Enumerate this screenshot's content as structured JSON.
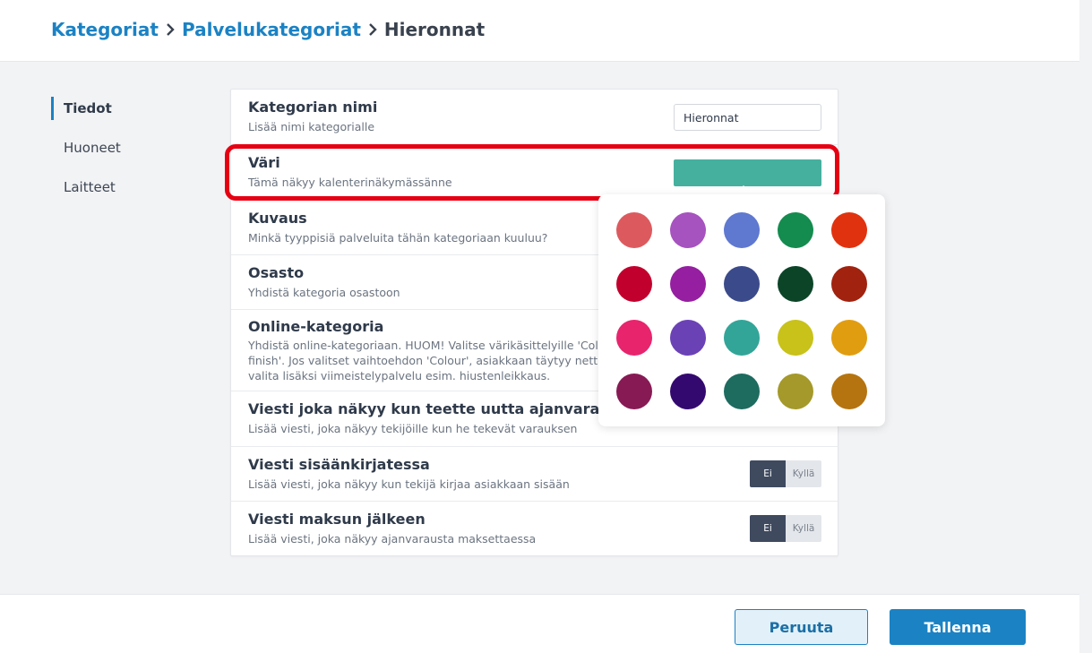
{
  "breadcrumb": {
    "items": [
      "Kategoriat",
      "Palvelukategoriat"
    ],
    "current": "Hieronnat"
  },
  "sidebar": {
    "items": [
      {
        "label": "Tiedot",
        "active": true
      },
      {
        "label": "Huoneet",
        "active": false
      },
      {
        "label": "Laitteet",
        "active": false
      }
    ]
  },
  "form": {
    "name": {
      "title": "Kategorian nimi",
      "desc": "Lisää nimi kategorialle",
      "value": "Hieronnat"
    },
    "color": {
      "title": "Väri",
      "desc": "Tämä näkyy kalenterinäkymässänne",
      "value": "#45b09e"
    },
    "description": {
      "title": "Kuvaus",
      "desc": "Minkä tyyppisiä palveluita tähän kategoriaan kuuluu?"
    },
    "department": {
      "title": "Osasto",
      "desc": "Yhdistä kategoria osastoon"
    },
    "online": {
      "title": "Online-kategoria",
      "desc_lines": [
        "Yhdistä online-kategoriaan. HUOM! Valitse värikäsittelyille 'Colour",
        "finish'. Jos valitset vaihtoehdon 'Colour', asiakkaan täytyy nettiajan",
        "valita lisäksi viimeistelypalvelu esim. hiustenleikkaus."
      ]
    },
    "booking_message": {
      "title": "Viesti joka näkyy kun teette uutta ajanvarausta",
      "desc": "Lisää viesti, joka näkyy tekijöille kun he tekevät varauksen"
    },
    "checkin_message": {
      "title": "Viesti sisäänkirjatessa",
      "desc": "Lisää viesti, joka näkyy kun tekijä kirjaa asiakkaan sisään",
      "off_label": "Ei",
      "on_label": "Kyllä"
    },
    "payment_message": {
      "title": "Viesti maksun jälkeen",
      "desc": "Lisää viesti, joka näkyy ajanvarausta maksettaessa",
      "off_label": "Ei",
      "on_label": "Kyllä"
    }
  },
  "palette": {
    "colors": [
      [
        "#dc5a5e",
        "#a652bf",
        "#5f78d0",
        "#148c4f",
        "#e1320f"
      ],
      [
        "#c2002d",
        "#951fa0",
        "#3b4a8a",
        "#0c4428",
        "#a0220f"
      ],
      [
        "#e8246d",
        "#6a42b6",
        "#32a598",
        "#c8c21a",
        "#e19d10"
      ],
      [
        "#871a54",
        "#34096f",
        "#1e6b60",
        "#a4992a",
        "#b5740f"
      ]
    ]
  },
  "footer": {
    "cancel_label": "Peruuta",
    "save_label": "Tallenna"
  }
}
